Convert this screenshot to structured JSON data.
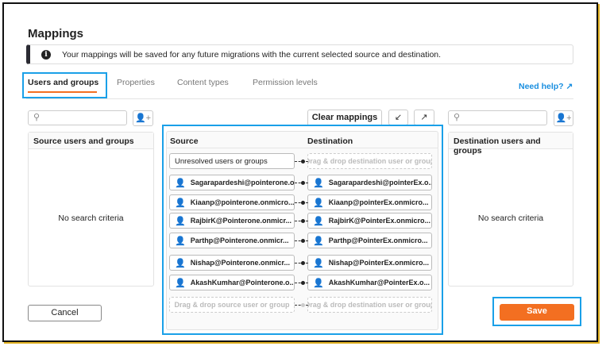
{
  "title": "Mappings",
  "banner": "Your mappings will be saved for any future migrations with the current selected source and destination.",
  "tabs": [
    "Users and groups",
    "Properties",
    "Content types",
    "Permission levels"
  ],
  "need_help": "Need help? ↗",
  "clear_mappings": "Clear mappings",
  "left_panel": {
    "title": "Source users and groups",
    "empty": "No search criteria"
  },
  "right_panel": {
    "title": "Destination users and groups",
    "empty": "No search criteria"
  },
  "center": {
    "source_header": "Source",
    "destination_header": "Destination",
    "unresolved": "Unresolved users or groups",
    "drop_dest": "Drag & drop destination user or group",
    "drop_source": "Drag & drop source user or group",
    "rows": [
      {
        "source": "Sagarapardeshi@pointerone.o...",
        "destination": "Sagarapardeshi@pointerEx.o..."
      },
      {
        "source": "Kiaanp@pointerone.onmicro...",
        "destination": "Kiaanp@pointerEx.onmicro..."
      },
      {
        "source": "RajbirK@Pointerone.onmicr...",
        "destination": "RajbirK@PointerEx.onmicro..."
      },
      {
        "source": "Parthp@Pointerone.onmicr...",
        "destination": "Parthp@PointerEx.onmicro..."
      },
      {
        "source": "Nishap@Pointerone.onmicr...",
        "destination": "Nishap@PointerEx.onmicro..."
      },
      {
        "source": "AkashKumhar@Pointerone.o...",
        "destination": "AkashKumhar@PointerEx.o..."
      }
    ]
  },
  "cancel": "Cancel",
  "save": "Save",
  "colors": {
    "accent": "#f36f21",
    "highlight": "#1aa0e8",
    "link": "#1a8fe0"
  }
}
